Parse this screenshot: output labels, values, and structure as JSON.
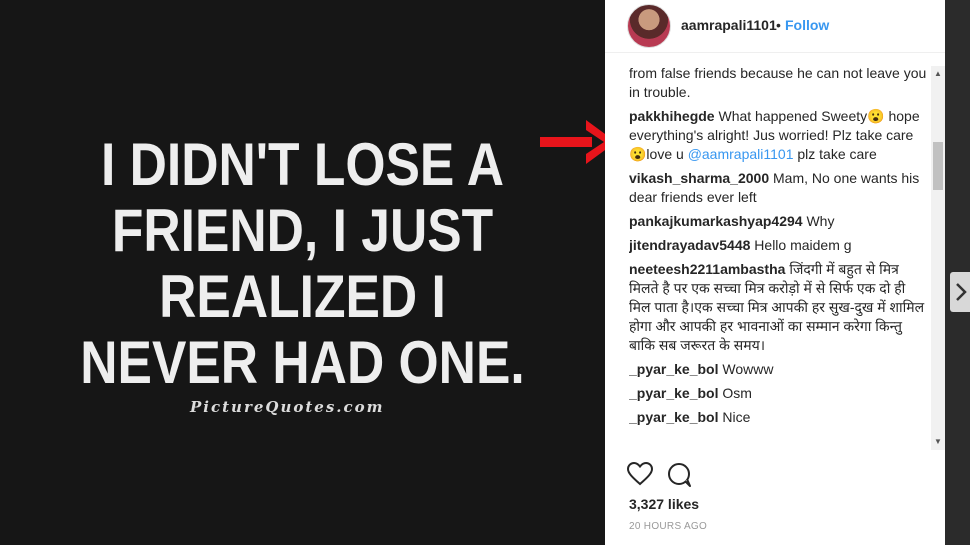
{
  "post": {
    "quote_lines": [
      "I DIDN'T LOSE A",
      "FRIEND, I JUST",
      "REALIZED I",
      "NEVER HAD ONE."
    ],
    "watermark": "PictureQuotes.com"
  },
  "header": {
    "username": "aamrapali1101",
    "separator": "•",
    "follow_label": "Follow"
  },
  "comments": [
    {
      "user": "",
      "text": "from false friends because he can not leave you in trouble."
    },
    {
      "user": "pakkhihegde",
      "text_parts": [
        "What happened Sweety😮 hope everything's alright! Jus worried! Plz take care😮love u ",
        "@aamrapali1101",
        " plz take care"
      ]
    },
    {
      "user": "vikash_sharma_2000",
      "text": "Mam, No one wants his dear friends ever left"
    },
    {
      "user": "pankajkumarkashyap4294",
      "text": "Why"
    },
    {
      "user": "jitendrayadav5448",
      "text": "Hello maidem g"
    },
    {
      "user": "neeteesh2211ambastha",
      "text": "जिंदगी में बहुत से मित्र मिलते है पर एक सच्चा मित्र करोड़ो में से सिर्फ एक दो ही मिल पाता है।एक सच्चा मित्र आपकी हर सुख-दुख में शामिल होगा और आपकी हर भावनाओं का सम्मान करेगा किन्तु बाकि सब जरूरत के समय।"
    },
    {
      "user": "_pyar_ke_bol",
      "text": "Wowww"
    },
    {
      "user": "_pyar_ke_bol",
      "text": "Osm"
    },
    {
      "user": "_pyar_ke_bol",
      "text": "Nice"
    }
  ],
  "stats": {
    "likes": "3,327 likes",
    "time": "20 HOURS AGO"
  },
  "icons": {
    "arrow_color": "#e8141b",
    "link_color": "#3897f0"
  }
}
